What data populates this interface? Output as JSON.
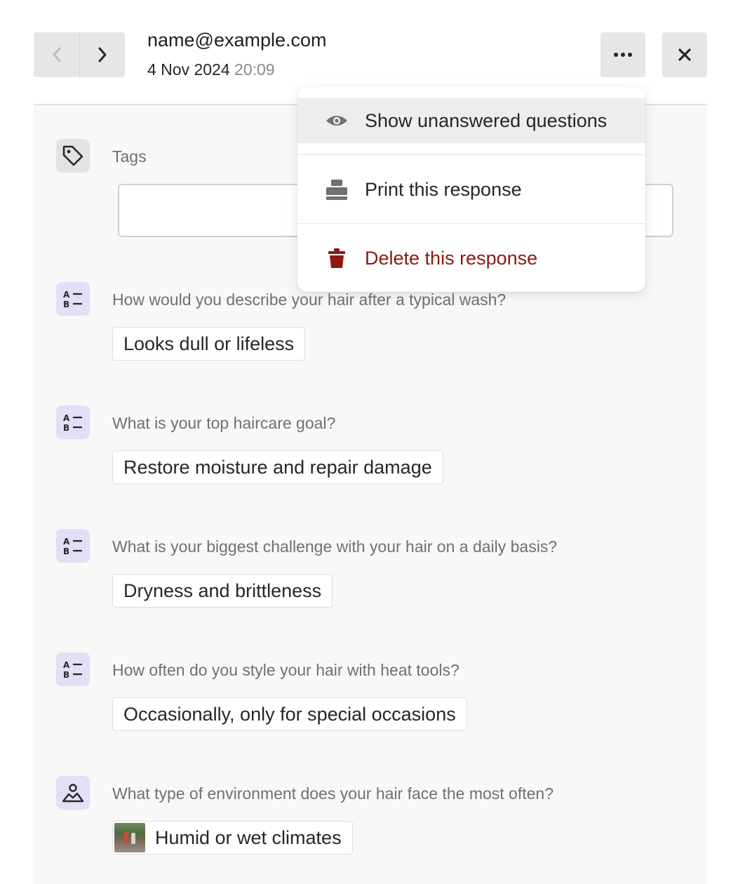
{
  "header": {
    "email": "name@example.com",
    "date": "4 Nov 2024",
    "time": "20:09"
  },
  "tags": {
    "label": "Tags",
    "value": ""
  },
  "questions": [
    {
      "text": "How would you describe your hair after a typical wash?",
      "answer": "Looks dull or lifeless",
      "icon": "multiple-choice-icon"
    },
    {
      "text": "What is your top haircare goal?",
      "answer": "Restore moisture and repair damage",
      "icon": "multiple-choice-icon"
    },
    {
      "text": "What is your biggest challenge with your hair on a daily basis?",
      "answer": "Dryness and brittleness",
      "icon": "multiple-choice-icon"
    },
    {
      "text": "How often do you style your hair with heat tools?",
      "answer": "Occasionally, only for special occasions",
      "icon": "multiple-choice-icon"
    },
    {
      "text": "What type of environment does your hair face the most often?",
      "answer": "Humid or wet climates",
      "icon": "picture-choice-icon"
    }
  ],
  "menu": {
    "items": [
      {
        "label": "Show unanswered questions",
        "icon": "eye-icon"
      },
      {
        "label": "Print this response",
        "icon": "printer-icon"
      },
      {
        "label": "Delete this response",
        "icon": "trash-icon"
      }
    ]
  },
  "colors": {
    "question_icon_bg": "#e4def6",
    "danger": "#8b1a12",
    "panel_bg": "#f8f8f8"
  }
}
